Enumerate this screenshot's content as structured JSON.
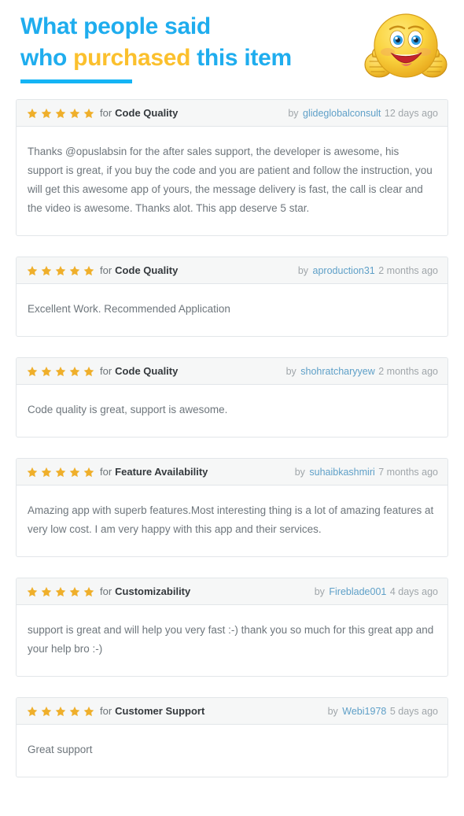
{
  "header": {
    "line1": "What people said",
    "line2_prefix": "who ",
    "line2_highlight": "purchased",
    "line2_suffix": " this item",
    "accent_blue": "#1FADEE",
    "accent_gold": "#FBC02D",
    "rule_color": "#14B4F5",
    "mascot_icon": "smiley-thumbs-up-icon"
  },
  "labels": {
    "for": "for",
    "by": "by"
  },
  "reviews": [
    {
      "stars": 5,
      "criteria": "Code Quality",
      "author": "glideglobalconsult",
      "ago": "12 days ago",
      "text": "Thanks @opuslabsin for the after sales support, the developer is awesome, his support is great, if you buy the code and you are patient and follow the instruction, you will get this awesome app of yours, the message delivery is fast, the call is clear and the video is awesome. Thanks alot. This app deserve 5 star."
    },
    {
      "stars": 5,
      "criteria": "Code Quality",
      "author": "aproduction31",
      "ago": "2 months ago",
      "text": "Excellent Work. Recommended Application"
    },
    {
      "stars": 5,
      "criteria": "Code Quality",
      "author": "shohratcharyyew",
      "ago": "2 months ago",
      "text": "Code quality is great, support is awesome."
    },
    {
      "stars": 5,
      "criteria": "Feature Availability",
      "author": "suhaibkashmiri",
      "ago": "7 months ago",
      "text": "Amazing app with superb features.Most interesting thing is a lot of amazing features at very low cost. I am very happy with this app and their services."
    },
    {
      "stars": 5,
      "criteria": "Customizability",
      "author": "Fireblade001",
      "ago": "4 days ago",
      "text": "support is great and will help you very fast :-) thank you so much for this great app and your help bro :-)"
    },
    {
      "stars": 5,
      "criteria": "Customer Support",
      "author": "Webi1978",
      "ago": "5 days ago",
      "text": "Great support"
    }
  ],
  "colors": {
    "star": "#EFAF2B",
    "author_link": "#5FA0C8",
    "meta_text": "#A0A6AA",
    "body_text": "#6E767C",
    "card_border": "#E2E6E9",
    "card_head_bg": "#F6F7F7"
  }
}
